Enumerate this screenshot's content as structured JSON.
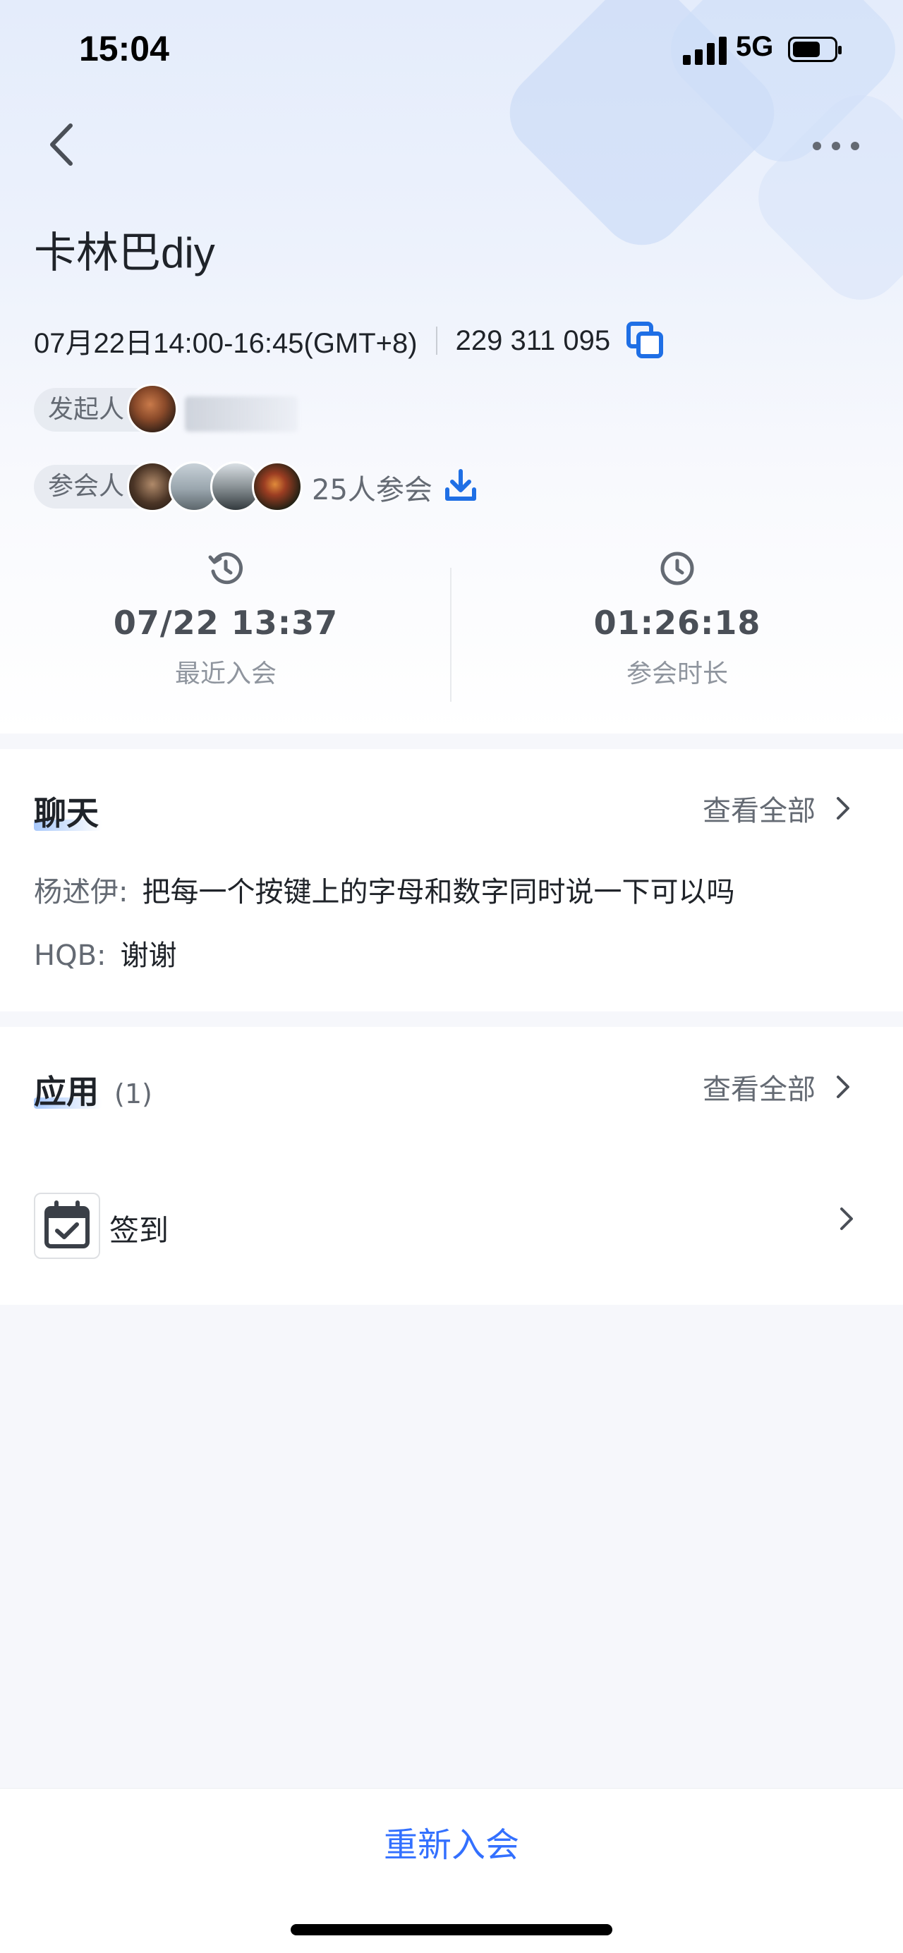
{
  "status_bar": {
    "time": "15:04",
    "network": "5G",
    "battery_level": 0.6
  },
  "header": {
    "back_icon": "chevron-left-icon",
    "more_icon": "more-horizontal-icon"
  },
  "meeting": {
    "title": "卡林巴diy",
    "time_range": "07月22日14:00-16:45(GMT+8)",
    "meeting_id": "229 311 095",
    "host_label": "发起人",
    "participants_label": "参会人",
    "participant_count": "25人参会"
  },
  "stats": {
    "last_join": {
      "value": "07/22 13:37",
      "label": "最近入会",
      "icon": "history-clock-icon"
    },
    "duration": {
      "value": "01:26:18",
      "label": "参会时长",
      "icon": "clock-icon"
    }
  },
  "chat": {
    "title": "聊天",
    "view_all": "查看全部",
    "messages": [
      {
        "sender": "杨述伊:",
        "text": "把每一个按键上的字母和数字同时说一下可以吗"
      },
      {
        "sender": "HQB:",
        "text": "谢谢"
      }
    ]
  },
  "apps": {
    "title": "应用",
    "count": "(1)",
    "view_all": "查看全部",
    "items": [
      {
        "label": "签到",
        "icon": "calendar-check-icon"
      }
    ]
  },
  "footer": {
    "rejoin_label": "重新入会"
  },
  "colors": {
    "accent": "#3370ff",
    "text_primary": "#1f2329",
    "text_secondary": "#646a73"
  }
}
